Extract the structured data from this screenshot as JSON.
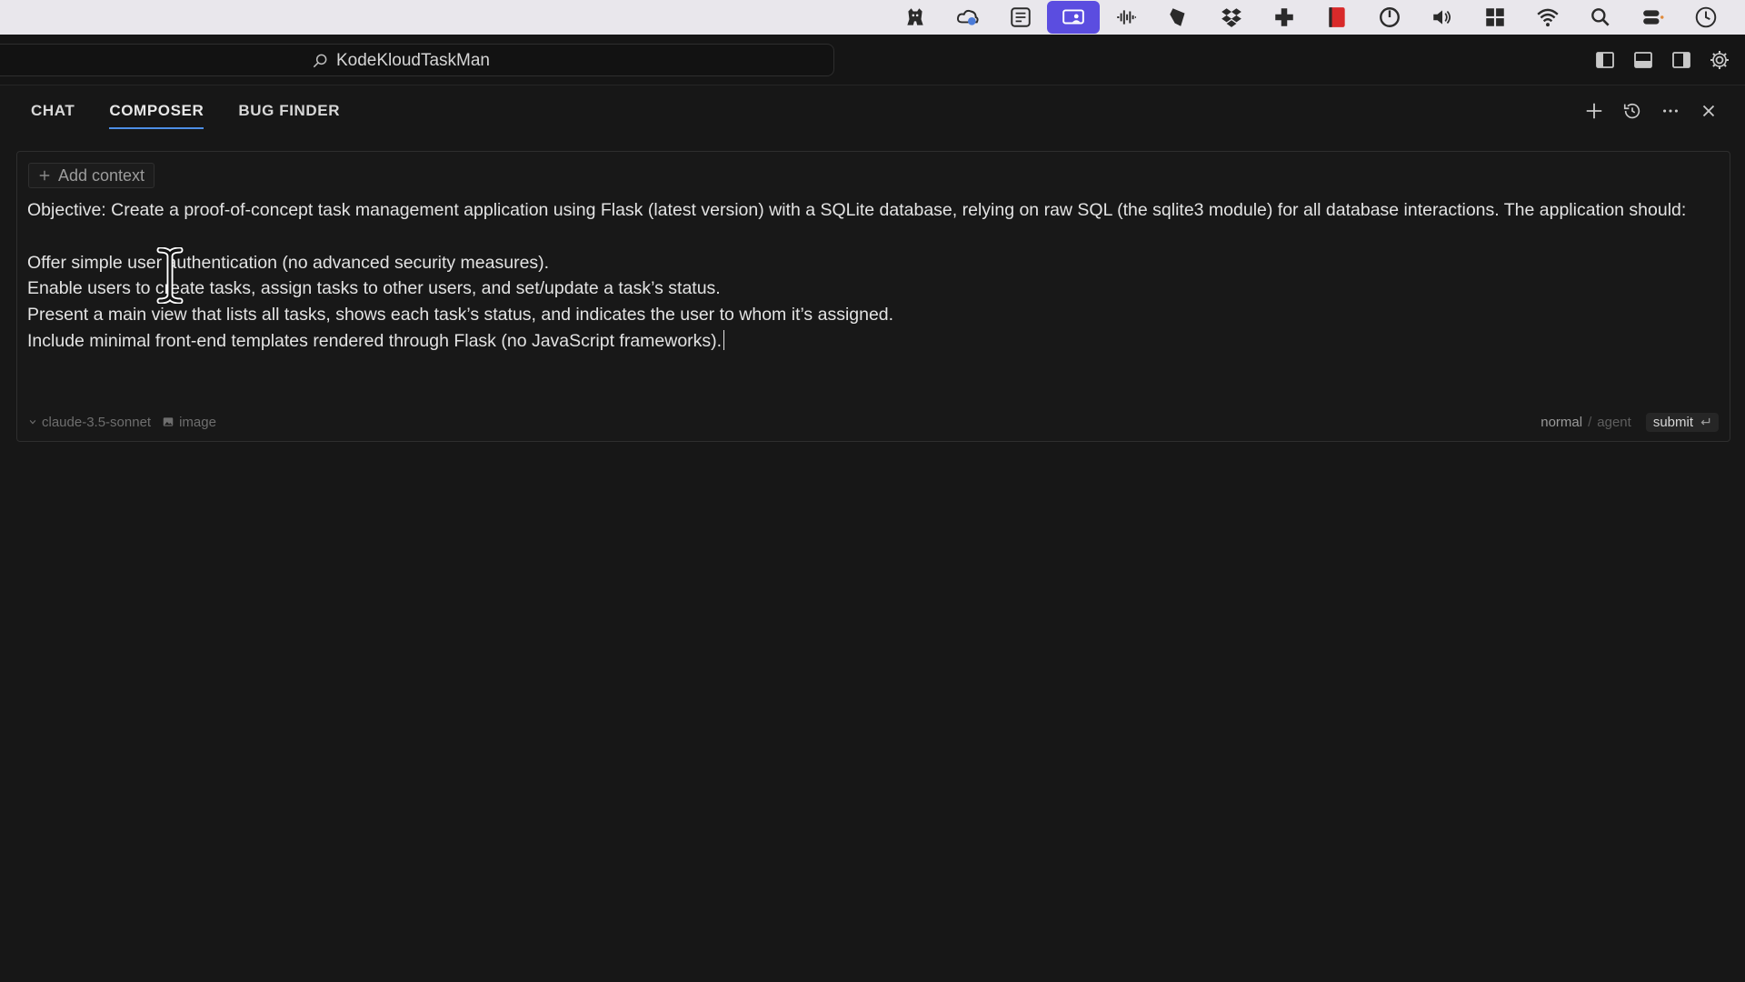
{
  "menubar": {
    "tray_icons": [
      "bear-icon",
      "cloud-sync-icon",
      "scanner-icon",
      "screen-share-icon",
      "audio-waveform-icon",
      "pen-icon",
      "dropbox-icon",
      "plus-cross-icon",
      "record-icon",
      "power-icon",
      "volume-icon",
      "grid-icon",
      "wifi-icon",
      "spotlight-search-icon",
      "control-center-icon",
      "clock-icon"
    ],
    "active_color": "#5b4de0"
  },
  "titlebar": {
    "search_text": "KodeKloudTaskMan"
  },
  "tabs": [
    {
      "label": "CHAT",
      "active": false
    },
    {
      "label": "COMPOSER",
      "active": true
    },
    {
      "label": "BUG FINDER",
      "active": false
    }
  ],
  "tab_accent": "#4e8fe6",
  "composer": {
    "add_context": "Add context",
    "lines": [
      "Objective: Create a proof-of-concept task management application using Flask (latest version) with a SQLite database, relying on raw SQL (the sqlite3 module) for all database interactions. The application should:",
      "",
      "Offer simple user authentication (no advanced security measures).",
      "Enable users to create tasks, assign tasks to other users, and set/update a task’s status.",
      "Present a main view that lists all tasks, shows each task’s status, and indicates the user to whom it’s assigned.",
      "Include minimal front-end templates rendered through Flask (no JavaScript frameworks)."
    ],
    "model": "claude-3.5-sonnet",
    "image_label": "image",
    "mode_normal": "normal",
    "mode_separator": "/",
    "mode_agent": "agent",
    "submit_label": "submit"
  }
}
